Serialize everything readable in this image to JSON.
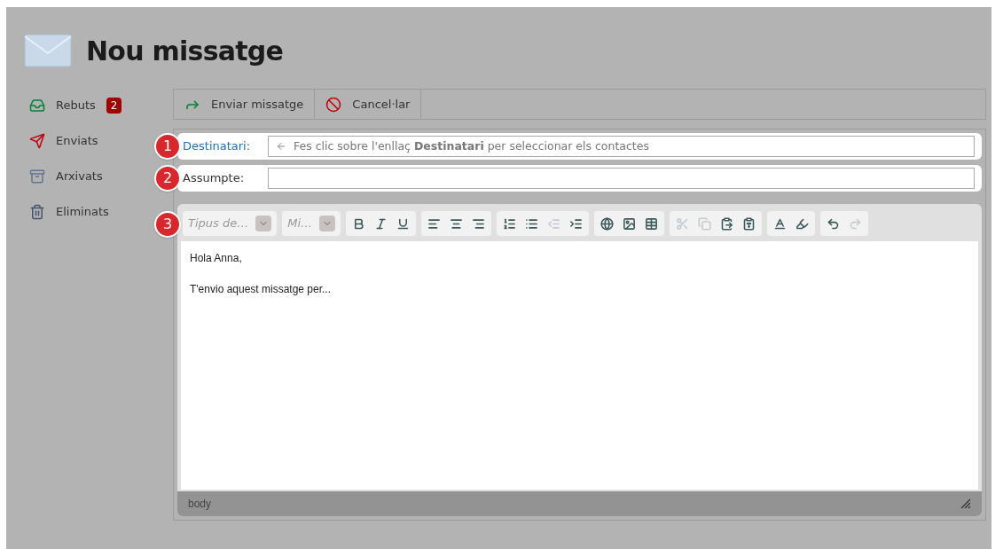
{
  "title": "Nou missatge",
  "sidebar": {
    "items": [
      {
        "kind": "inbox",
        "label": "Rebuts",
        "badge": "2"
      },
      {
        "kind": "sent",
        "label": "Enviats"
      },
      {
        "kind": "archive",
        "label": "Arxivats"
      },
      {
        "kind": "trash",
        "label": "Eliminats"
      }
    ]
  },
  "actions": [
    {
      "kind": "send",
      "label": "Enviar missatge"
    },
    {
      "kind": "cancel",
      "label": "Cancel·lar"
    }
  ],
  "callouts": [
    "1",
    "2",
    "3"
  ],
  "recipient": {
    "label": "Destinatari:",
    "hint": "Fes clic sobre l'enllaç **Destinatari** per seleccionar els contactes"
  },
  "subject": {
    "label": "Assumpte:"
  },
  "editor": {
    "dropdowns": [
      {
        "placeholder": "Tipus de…"
      },
      {
        "placeholder": "Mi…"
      }
    ],
    "groups": [
      [
        {
          "kind": "bold",
          "disabled": false
        },
        {
          "kind": "italic",
          "disabled": false
        },
        {
          "kind": "underline",
          "disabled": false
        }
      ],
      [
        {
          "kind": "align-left",
          "disabled": false
        },
        {
          "kind": "align-center",
          "disabled": false
        },
        {
          "kind": "align-right",
          "disabled": false
        }
      ],
      [
        {
          "kind": "ordered-list",
          "disabled": false
        },
        {
          "kind": "bullet-list",
          "disabled": false
        },
        {
          "kind": "outdent",
          "disabled": true
        },
        {
          "kind": "indent",
          "disabled": false
        }
      ],
      [
        {
          "kind": "link",
          "disabled": false
        },
        {
          "kind": "image",
          "disabled": false
        },
        {
          "kind": "table",
          "disabled": false
        }
      ],
      [
        {
          "kind": "cut",
          "disabled": true
        },
        {
          "kind": "copy",
          "disabled": true
        },
        {
          "kind": "paste",
          "disabled": false
        },
        {
          "kind": "paste-word",
          "disabled": false
        }
      ],
      [
        {
          "kind": "text-color",
          "disabled": false
        },
        {
          "kind": "highlight",
          "disabled": false
        }
      ],
      [
        {
          "kind": "undo",
          "disabled": false
        },
        {
          "kind": "redo",
          "disabled": true
        }
      ]
    ],
    "body": [
      "Hola Anna,",
      "T'envio aquest missatge per..."
    ],
    "status": "body"
  }
}
